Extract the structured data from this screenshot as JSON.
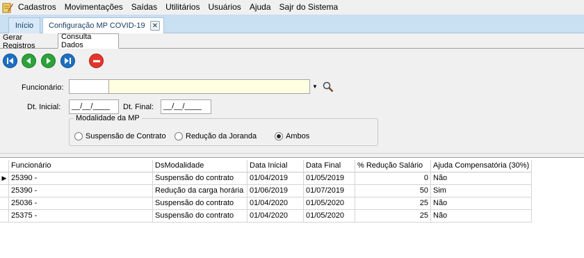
{
  "menu": {
    "items": [
      "Cadastros",
      "Movimentações",
      "Saídas",
      "Utilitários",
      "Usuários",
      "Ajuda",
      "Sajr do Sistema"
    ]
  },
  "doc_tabs": {
    "home": "Início",
    "active": "Configuração MP COVID-19"
  },
  "sub_tabs": {
    "gerar": "Gerar Registros",
    "consulta": "Consulta Dados"
  },
  "icons": {
    "app": "notepad-pencil-icon",
    "nav_first": "first-record-icon",
    "nav_prev": "previous-record-icon",
    "nav_next": "next-record-icon",
    "nav_last": "last-record-icon",
    "cancel": "no-entry-icon",
    "search": "magnifier-icon",
    "dropdown": "dropdown-arrow-icon",
    "tab_close": "close-icon",
    "current_row": "row-pointer-icon"
  },
  "form": {
    "funcionario_label": "Funcionário:",
    "funcionario_code": "",
    "funcionario_name": "",
    "dt_inicial_label": "Dt. Inicial:",
    "dt_inicial_value": "__/__/____",
    "dt_final_label": "Dt. Final:",
    "dt_final_value": "__/__/____",
    "modalidade_title": "Modalidade da MP",
    "options": [
      "Suspensão de Contrato",
      "Redução da Joranda",
      "Ambos"
    ],
    "selected": "Ambos"
  },
  "grid": {
    "columns": [
      "Funcionário",
      "DsModalidade",
      "Data Inicial",
      "Data Final",
      "% Redução Salário",
      "Ajuda Compensatória (30%)"
    ],
    "rows": [
      [
        "25390 -",
        "Suspensão do contrato",
        "01/04/2019",
        "01/05/2019",
        "0",
        "Não"
      ],
      [
        "25390 -",
        "Redução da carga horária",
        "01/06/2019",
        "01/07/2019",
        "50",
        "Sim"
      ],
      [
        "25036 -",
        "Suspensão do contrato",
        "01/04/2020",
        "01/05/2020",
        "25",
        "Não"
      ],
      [
        "25375 -",
        "Suspensão do contrato",
        "01/04/2020",
        "01/05/2020",
        "25",
        "Não"
      ]
    ],
    "current_row": 0
  },
  "colors": {
    "tabstrip_bg": "#c9dff2",
    "nav_blue": "#1d6fc0",
    "nav_green": "#2da23a",
    "cancel_red": "#e2362b",
    "name_field_bg": "#ffffe1"
  }
}
